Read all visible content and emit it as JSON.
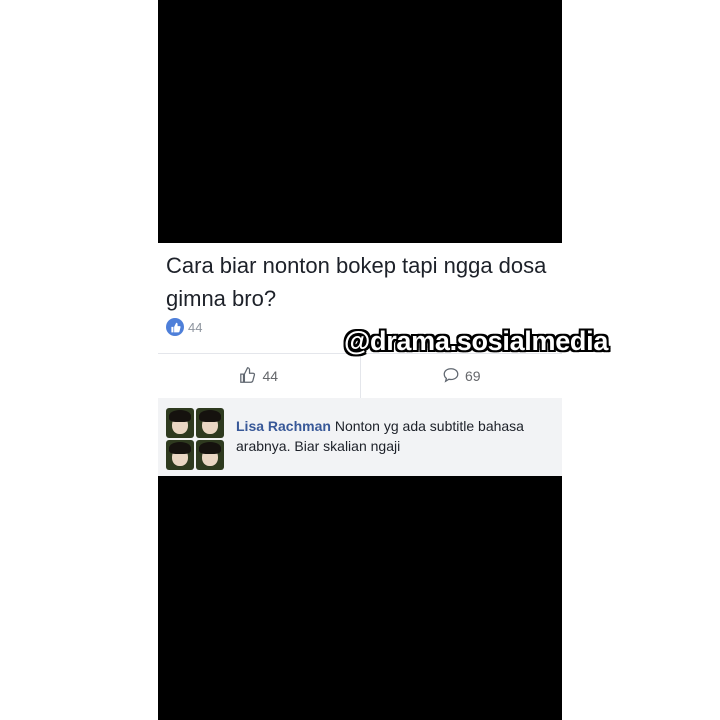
{
  "post": {
    "text": "Cara biar nonton bokep tapi ngga dosa gimna bro?",
    "reaction_count": "44"
  },
  "actions": {
    "like_count": "44",
    "comment_count": "69"
  },
  "comment": {
    "author": "Lisa Rachman",
    "text": "Nonton yg ada subtitle bahasa arabnya. Biar skalian ngaji"
  },
  "watermark": "@drama.sosialmedia",
  "colors": {
    "like_badge": "#4e7fd9",
    "author_name": "#385898",
    "comment_bg": "#f2f3f5"
  }
}
